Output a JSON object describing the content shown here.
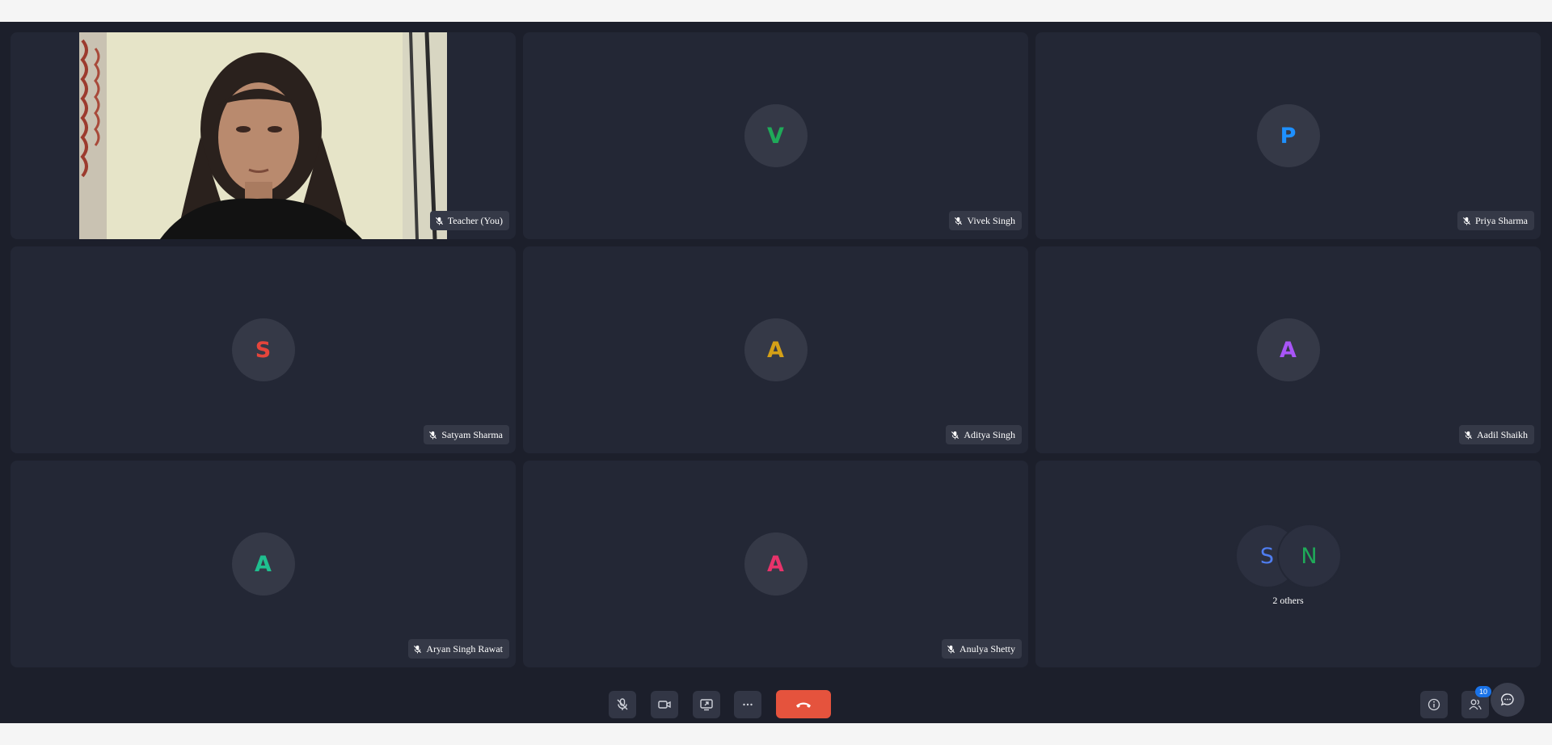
{
  "participants": [
    {
      "name": "Teacher (You)",
      "initial": "",
      "color": "",
      "has_video": true
    },
    {
      "name": "Vivek Singh",
      "initial": "V",
      "color": "#1faa59"
    },
    {
      "name": "Priya Sharma",
      "initial": "P",
      "color": "#1e90ff"
    },
    {
      "name": "Satyam Sharma",
      "initial": "S",
      "color": "#e5453b"
    },
    {
      "name": "Aditya Singh",
      "initial": "A",
      "color": "#d4a017"
    },
    {
      "name": "Aadil Shaikh",
      "initial": "A",
      "color": "#a855f7"
    },
    {
      "name": "Aryan Singh Rawat",
      "initial": "A",
      "color": "#1fbf8f"
    },
    {
      "name": "Anulya Shetty",
      "initial": "A",
      "color": "#e8336b"
    }
  ],
  "others": {
    "initials": [
      "S",
      "N"
    ],
    "colors": [
      "#4f7df0",
      "#1faa59"
    ],
    "label": "2 others"
  },
  "toolbar": {
    "participants_count": "10",
    "icons": [
      "mic-off-icon",
      "camera-icon",
      "share-screen-icon",
      "more-icon",
      "end-call-icon",
      "info-icon",
      "people-icon",
      "chat-icon"
    ],
    "end_call_color": "#e5533d"
  }
}
